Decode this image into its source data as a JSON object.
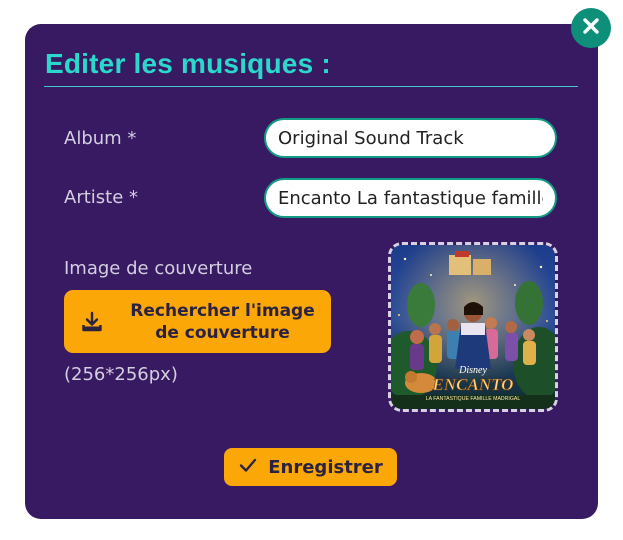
{
  "modal": {
    "title": "Editer les musiques :",
    "close_icon": "close-icon"
  },
  "form": {
    "album": {
      "label": "Album *",
      "value": "Original Sound Track"
    },
    "artist": {
      "label": "Artiste *",
      "value": "Encanto La fantastique famille Madrigal"
    },
    "cover": {
      "label": "Image de couverture",
      "button_label": "Rechercher l'image de couverture",
      "button_icon": "download-icon",
      "size_hint": "(256*256px)",
      "image_brand": "Disney",
      "image_title": "ENCANTO",
      "image_subtitle": "LA FANTASTIQUE FAMILLE MADRIGAL"
    }
  },
  "actions": {
    "save_label": "Enregistrer",
    "save_icon": "check-icon"
  },
  "colors": {
    "modal_bg": "#381a63",
    "accent_teal": "#2bd9cc",
    "close_bg": "#0d8f7a",
    "button_orange": "#fba707",
    "field_border": "#129c86"
  }
}
